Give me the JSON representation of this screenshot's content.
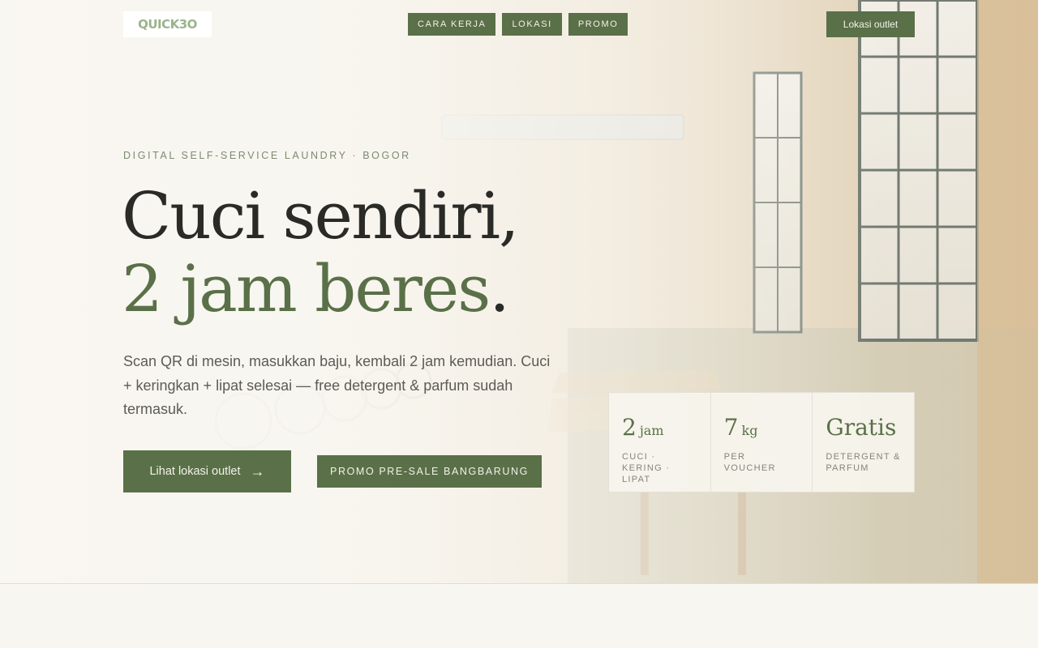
{
  "header": {
    "logo_text": "QUICK3O",
    "nav": [
      "CARA KERJA",
      "LOKASI",
      "PROMO"
    ],
    "outlet_button": "Lokasi outlet"
  },
  "hero": {
    "eyebrow": "DIGITAL SELF-SERVICE LAUNDRY · BOGOR",
    "headline_line1": "Cuci sendiri,",
    "headline_line2_accent": "2 jam beres",
    "headline_line2_end": ".",
    "lead": "Scan QR di mesin, masukkan baju, kembali 2 jam kemudian. Cuci + keringkan + lipat selesai — free detergent & parfum sudah termasuk.",
    "cta_primary": "Lihat lokasi outlet",
    "cta_primary_arrow": "→",
    "cta_secondary": "PROMO PRE-SALE BANGBARUNG"
  },
  "stats": [
    {
      "value": "2",
      "unit": "jam",
      "label": "CUCI · KERING · LIPAT"
    },
    {
      "value": "7",
      "unit": "kg",
      "label": "PER VOUCHER"
    },
    {
      "value": "Gratis",
      "unit": "",
      "label": "DETERGENT & PARFUM"
    }
  ],
  "colors": {
    "accent": "#5a7048",
    "background": "#f8f6f1",
    "logo": "#9ab48a",
    "text_dark": "#2a2a27"
  }
}
